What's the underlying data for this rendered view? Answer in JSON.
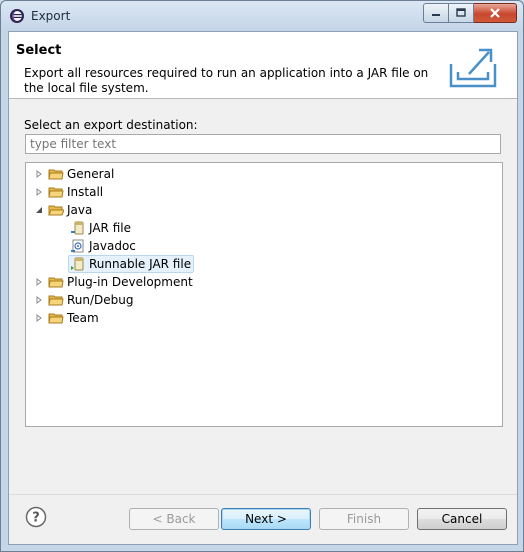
{
  "window": {
    "title": "Export"
  },
  "header": {
    "title": "Select",
    "description": "Export all resources required to run an application into a JAR file on the local file system."
  },
  "destination": {
    "label": "Select an export destination:",
    "filter_placeholder": "type filter text"
  },
  "tree": {
    "items": [
      {
        "label": "General",
        "kind": "folder",
        "expanded": false
      },
      {
        "label": "Install",
        "kind": "folder",
        "expanded": false
      },
      {
        "label": "Java",
        "kind": "folder",
        "expanded": true
      },
      {
        "label": "JAR file",
        "kind": "jar-file",
        "child_of": "Java"
      },
      {
        "label": "Javadoc",
        "kind": "javadoc",
        "child_of": "Java"
      },
      {
        "label": "Runnable JAR file",
        "kind": "runnable-jar",
        "child_of": "Java",
        "selected": true
      },
      {
        "label": "Plug-in Development",
        "kind": "folder",
        "expanded": false
      },
      {
        "label": "Run/Debug",
        "kind": "folder",
        "expanded": false
      },
      {
        "label": "Team",
        "kind": "folder",
        "expanded": false
      }
    ]
  },
  "buttons": {
    "back": "< Back",
    "next": "Next >",
    "finish": "Finish",
    "cancel": "Cancel"
  },
  "colors": {
    "folder": "#e8b84a",
    "selection": "#e5f1fb",
    "close_button": "#c8472f"
  },
  "icons": {
    "title": "eclipse-icon",
    "header": "export-icon",
    "help": "help-icon"
  }
}
